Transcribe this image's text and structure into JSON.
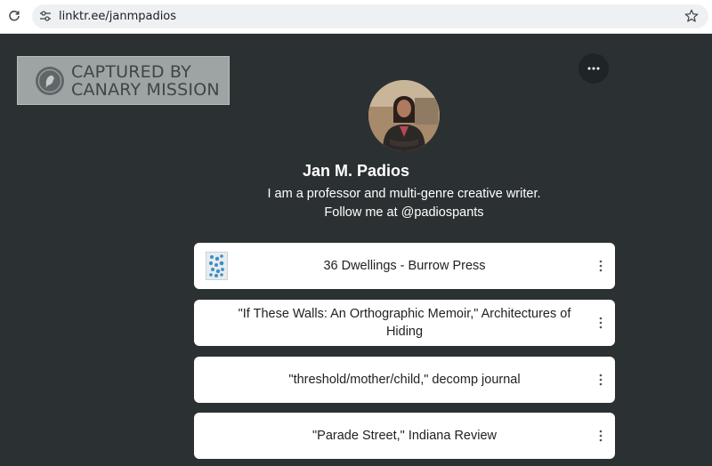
{
  "browser": {
    "url": "linktr.ee/janmpadios"
  },
  "watermark": {
    "line1": "CAPTURED BY",
    "line2": "CANARY MISSION"
  },
  "profile": {
    "name": "Jan M. Padios",
    "bio": "I am a professor and multi-genre creative writer. Follow me at @padiospants"
  },
  "links": [
    {
      "label": "36 Dwellings - Burrow Press",
      "has_thumbnail": true
    },
    {
      "label": "\"If These Walls: An Orthographic Memoir,\" Architectures of Hiding",
      "has_thumbnail": false
    },
    {
      "label": "\"threshold/mother/child,\" decomp journal",
      "has_thumbnail": false
    },
    {
      "label": "\"Parade Street,\" Indiana Review",
      "has_thumbnail": false
    }
  ],
  "colors": {
    "background": "#2b3032",
    "card": "#ffffff",
    "watermark": "#9ea3a4"
  },
  "icons": [
    "reload-icon",
    "site-settings-icon",
    "bookmark-star-icon",
    "more-options-icon",
    "canary-logo-icon",
    "kebab-menu-icon"
  ]
}
